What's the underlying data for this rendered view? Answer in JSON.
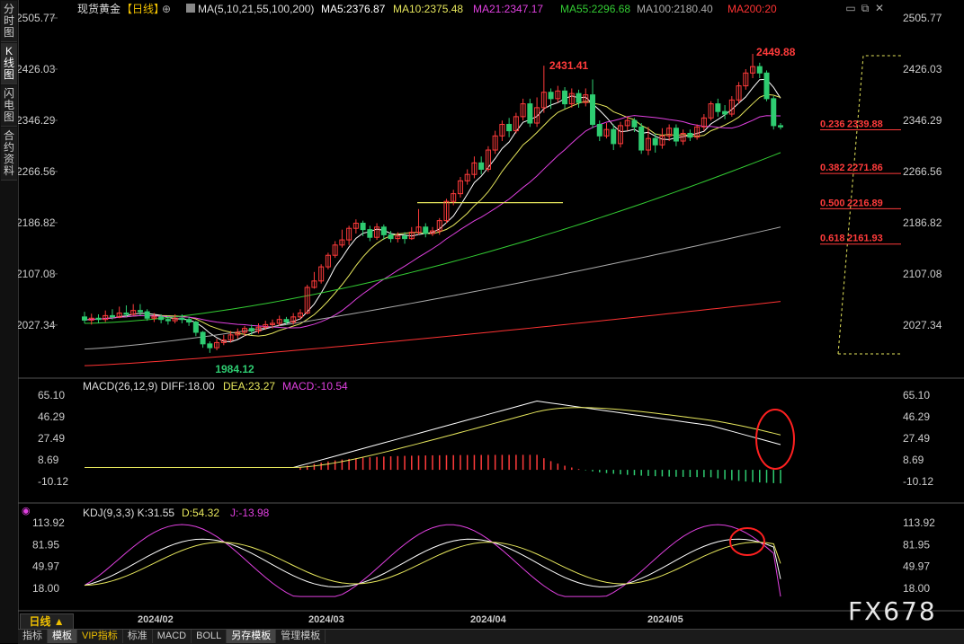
{
  "sidebar": [
    {
      "label": "分时图",
      "active": false
    },
    {
      "label": "K线图",
      "active": true
    },
    {
      "label": "闪电图",
      "active": false
    },
    {
      "label": "合约资料",
      "active": false
    }
  ],
  "header": {
    "symbol": "现货黄金",
    "period_tag": "【日线】",
    "ma_label": "MA(5,10,21,55,100,200)",
    "ma_items": [
      {
        "text": "MA5:2376.87",
        "color": "#ffffff"
      },
      {
        "text": "MA10:2375.48",
        "color": "#e6e65c"
      },
      {
        "text": "MA21:2347.17",
        "color": "#e040e0"
      },
      {
        "text": "MA55:2296.68",
        "color": "#33cc33"
      },
      {
        "text": "MA100:2180.40",
        "color": "#aaaaaa"
      },
      {
        "text": "MA200:20",
        "color": "#ff3333"
      }
    ]
  },
  "top_icons": [
    "window-icon",
    "restore-icon",
    "close-icon"
  ],
  "price_axis_left": [
    "2505.77",
    "2426.03",
    "2346.29",
    "2266.56",
    "2186.82",
    "2107.08",
    "2027.34"
  ],
  "price_axis_right": [
    "2505.77",
    "2426.03",
    "2346.29",
    "2266.56",
    "2186.82",
    "2107.08",
    "2027.34"
  ],
  "annotations": {
    "high1": "2431.41",
    "high2": "2449.88",
    "low": "1984.12"
  },
  "fib_levels": [
    {
      "ratio": "0.236",
      "value": "2339.88"
    },
    {
      "ratio": "0.382",
      "value": "2271.86"
    },
    {
      "ratio": "0.500",
      "value": "2216.89"
    },
    {
      "ratio": "0.618",
      "value": "2161.93"
    }
  ],
  "macd_header": {
    "label": "MACD(26,12,9)",
    "diff": "DIFF:18.00",
    "dea": "DEA:23.27",
    "macd": "MACD:-10.54"
  },
  "macd_axis": [
    "65.10",
    "46.29",
    "27.49",
    "8.69",
    "-10.12"
  ],
  "kdj_header": {
    "label": "KDJ(9,3,3)",
    "k": "K:31.55",
    "d": "D:54.32",
    "j": "J:-13.98"
  },
  "kdj_axis": [
    "113.92",
    "81.95",
    "49.97",
    "18.00"
  ],
  "x_axis": [
    "2024/02",
    "2024/03",
    "2024/04",
    "2024/05"
  ],
  "period_button": "日线 ▲",
  "bottom_tabs": [
    {
      "label": "指标",
      "active": false,
      "vip": false
    },
    {
      "label": "模板",
      "active": true,
      "vip": false
    },
    {
      "label": "VIP指标",
      "active": false,
      "vip": true
    },
    {
      "label": "标准",
      "active": false,
      "vip": false
    },
    {
      "label": "MACD",
      "active": false,
      "vip": false
    },
    {
      "label": "BOLL",
      "active": false,
      "vip": false
    },
    {
      "label": "另存模板",
      "active": true,
      "vip": false
    },
    {
      "label": "管理模板",
      "active": false,
      "vip": false
    }
  ],
  "watermark": "FX678",
  "colors": {
    "up": "#ff3b3b",
    "down": "#2ecc71",
    "grid": "#333333",
    "axis_text": "#cccccc"
  },
  "chart_data": {
    "type": "candlestick",
    "ylim": [
      1960,
      2505.77
    ],
    "candles": [
      [
        2040,
        2035,
        2048,
        2030
      ],
      [
        2035,
        2038,
        2045,
        2028
      ],
      [
        2038,
        2036,
        2044,
        2030
      ],
      [
        2036,
        2042,
        2050,
        2032
      ],
      [
        2042,
        2040,
        2052,
        2036
      ],
      [
        2040,
        2046,
        2056,
        2038
      ],
      [
        2046,
        2044,
        2058,
        2040
      ],
      [
        2044,
        2050,
        2060,
        2042
      ],
      [
        2050,
        2048,
        2060,
        2042
      ],
      [
        2048,
        2038,
        2052,
        2034
      ],
      [
        2038,
        2040,
        2046,
        2032
      ],
      [
        2040,
        2036,
        2044,
        2030
      ],
      [
        2036,
        2034,
        2042,
        2028
      ],
      [
        2034,
        2038,
        2044,
        2030
      ],
      [
        2038,
        2036,
        2044,
        2030
      ],
      [
        2036,
        2032,
        2040,
        2026
      ],
      [
        2032,
        2016,
        2034,
        2010
      ],
      [
        2016,
        1998,
        2018,
        1992
      ],
      [
        1998,
        1992,
        2002,
        1984
      ],
      [
        1992,
        2000,
        2006,
        1988
      ],
      [
        2000,
        2004,
        2012,
        1996
      ],
      [
        2004,
        2012,
        2018,
        2000
      ],
      [
        2012,
        2016,
        2022,
        2006
      ],
      [
        2016,
        2022,
        2026,
        2010
      ],
      [
        2022,
        2018,
        2028,
        2012
      ],
      [
        2018,
        2024,
        2030,
        2014
      ],
      [
        2024,
        2028,
        2034,
        2020
      ],
      [
        2028,
        2030,
        2036,
        2022
      ],
      [
        2030,
        2036,
        2042,
        2026
      ],
      [
        2036,
        2032,
        2040,
        2028
      ],
      [
        2032,
        2040,
        2046,
        2028
      ],
      [
        2040,
        2046,
        2052,
        2036
      ],
      [
        2046,
        2086,
        2090,
        2044
      ],
      [
        2086,
        2096,
        2110,
        2084
      ],
      [
        2096,
        2118,
        2122,
        2092
      ],
      [
        2118,
        2136,
        2140,
        2114
      ],
      [
        2136,
        2152,
        2158,
        2132
      ],
      [
        2152,
        2160,
        2176,
        2148
      ],
      [
        2160,
        2178,
        2182,
        2152
      ],
      [
        2178,
        2186,
        2192,
        2170
      ],
      [
        2186,
        2176,
        2190,
        2166
      ],
      [
        2176,
        2164,
        2182,
        2158
      ],
      [
        2164,
        2180,
        2186,
        2160
      ],
      [
        2180,
        2168,
        2184,
        2160
      ],
      [
        2168,
        2162,
        2174,
        2156
      ],
      [
        2162,
        2166,
        2172,
        2156
      ],
      [
        2166,
        2162,
        2172,
        2154
      ],
      [
        2162,
        2172,
        2180,
        2160
      ],
      [
        2172,
        2180,
        2208,
        2168
      ],
      [
        2180,
        2170,
        2186,
        2164
      ],
      [
        2170,
        2174,
        2180,
        2166
      ],
      [
        2174,
        2190,
        2194,
        2168
      ],
      [
        2190,
        2220,
        2224,
        2186
      ],
      [
        2220,
        2232,
        2238,
        2214
      ],
      [
        2232,
        2252,
        2258,
        2226
      ],
      [
        2252,
        2262,
        2270,
        2246
      ],
      [
        2262,
        2280,
        2290,
        2256
      ],
      [
        2280,
        2270,
        2290,
        2262
      ],
      [
        2270,
        2300,
        2306,
        2266
      ],
      [
        2300,
        2322,
        2330,
        2294
      ],
      [
        2322,
        2340,
        2346,
        2314
      ],
      [
        2340,
        2330,
        2350,
        2320
      ],
      [
        2330,
        2352,
        2358,
        2326
      ],
      [
        2352,
        2372,
        2380,
        2346
      ],
      [
        2372,
        2342,
        2380,
        2336
      ],
      [
        2342,
        2366,
        2382,
        2336
      ],
      [
        2366,
        2390,
        2431.41,
        2358
      ],
      [
        2390,
        2380,
        2396,
        2364
      ],
      [
        2380,
        2392,
        2400,
        2374
      ],
      [
        2392,
        2372,
        2398,
        2364
      ],
      [
        2372,
        2388,
        2396,
        2366
      ],
      [
        2388,
        2374,
        2394,
        2366
      ],
      [
        2374,
        2386,
        2396,
        2368
      ],
      [
        2386,
        2340,
        2410,
        2334
      ],
      [
        2340,
        2322,
        2346,
        2314
      ],
      [
        2322,
        2332,
        2342,
        2318
      ],
      [
        2332,
        2310,
        2340,
        2300
      ],
      [
        2310,
        2338,
        2344,
        2304
      ],
      [
        2338,
        2346,
        2352,
        2330
      ],
      [
        2346,
        2336,
        2350,
        2328
      ],
      [
        2336,
        2300,
        2342,
        2294
      ],
      [
        2300,
        2318,
        2336,
        2292
      ],
      [
        2318,
        2308,
        2326,
        2296
      ],
      [
        2308,
        2322,
        2334,
        2302
      ],
      [
        2322,
        2334,
        2340,
        2314
      ],
      [
        2334,
        2314,
        2340,
        2306
      ],
      [
        2314,
        2326,
        2332,
        2308
      ],
      [
        2326,
        2320,
        2332,
        2314
      ],
      [
        2320,
        2336,
        2340,
        2316
      ],
      [
        2336,
        2350,
        2356,
        2330
      ],
      [
        2350,
        2372,
        2376,
        2346
      ],
      [
        2372,
        2360,
        2380,
        2352
      ],
      [
        2360,
        2356,
        2370,
        2348
      ],
      [
        2356,
        2378,
        2384,
        2352
      ],
      [
        2378,
        2400,
        2406,
        2372
      ],
      [
        2400,
        2420,
        2426,
        2394
      ],
      [
        2420,
        2430,
        2449.88,
        2412
      ],
      [
        2430,
        2420,
        2436,
        2412
      ],
      [
        2420,
        2380,
        2424,
        2376
      ],
      [
        2380,
        2338,
        2384,
        2332
      ],
      [
        2338,
        2336,
        2342,
        2332
      ]
    ]
  }
}
